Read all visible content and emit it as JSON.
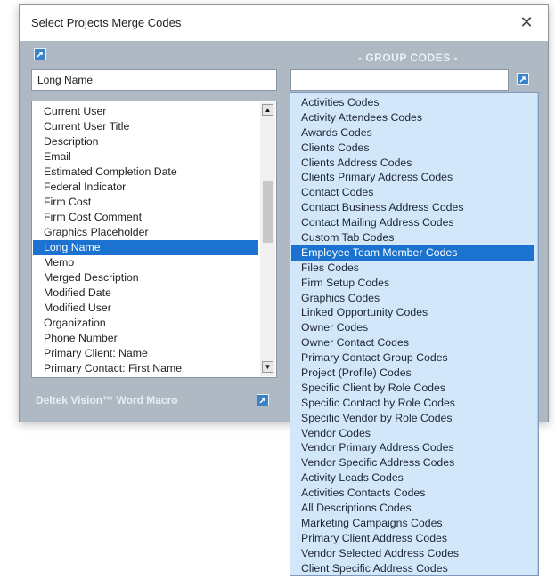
{
  "window": {
    "title": "Select Projects Merge Codes",
    "close_glyph": "✕"
  },
  "icons": {
    "top_left_button": "arrow-icon",
    "group_button": "arrow-icon",
    "footer_button": "arrow-icon",
    "close": "close-icon"
  },
  "colors": {
    "dialog_bg": "#afb9c4",
    "accent": "#1b73cf",
    "dropdown_bg": "#d3e7fb"
  },
  "group_codes": {
    "header": "- GROUP CODES -",
    "input_value": ""
  },
  "field_input": {
    "value": "Long Name"
  },
  "fields_list": {
    "items": [
      "Current User",
      "Current User Title",
      "Description",
      "Email",
      "Estimated Completion Date",
      "Federal Indicator",
      "Firm Cost",
      "Firm Cost Comment",
      "Graphics Placeholder",
      "Long Name",
      "Memo",
      "Merged Description",
      "Modified Date",
      "Modified User",
      "Organization",
      "Phone Number",
      "Primary Client: Name",
      "Primary Contact: First Name"
    ],
    "selected": "Long Name",
    "scroll_up": "▲",
    "scroll_down": "▼"
  },
  "footer": {
    "label": "Deltek Vision™ Word Macro"
  },
  "group_dropdown": {
    "items": [
      "Activities Codes",
      "Activity Attendees Codes",
      "Awards Codes",
      "Clients Codes",
      "Clients Address Codes",
      "Clients Primary Address Codes",
      "Contact Codes",
      "Contact Business Address Codes",
      "Contact Mailing Address Codes",
      "Custom Tab Codes",
      "Employee Team Member Codes",
      "Files Codes",
      "Firm Setup Codes",
      "Graphics Codes",
      "Linked Opportunity Codes",
      "Owner Codes",
      "Owner Contact Codes",
      "Primary Contact Group Codes",
      "Project (Profile) Codes",
      "Specific Client by Role Codes",
      "Specific Contact by Role Codes",
      "Specific Vendor by Role Codes",
      "Vendor Codes",
      "Vendor Primary Address Codes",
      "Vendor Specific Address Codes",
      "Activity Leads Codes",
      "Activities Contacts Codes",
      "All Descriptions Codes",
      "Marketing Campaigns Codes",
      "Primary Client Address Codes",
      "Vendor Selected Address Codes",
      "Client Specific Address Codes"
    ],
    "selected": "Employee Team Member Codes"
  }
}
